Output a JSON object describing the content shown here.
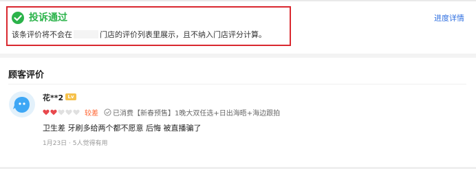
{
  "banner": {
    "title": "投诉通过",
    "desc_prefix": "该条评价将不会在",
    "desc_suffix": "门店的评价列表里展示，且不纳入门店评分计算。",
    "status_color": "#2bb34a",
    "highlight_border": "#d9272e"
  },
  "progress_link": "进度详情",
  "section_title": "顾客评价",
  "review": {
    "username": "花**2",
    "hearts_filled": 2,
    "hearts_total": 5,
    "rating_label": "较差",
    "consumed": "已消费【新春预售】1晚大双任选+日出海晤+海边跟拍",
    "text": "卫生差 牙刷多给两个都不愿意 后悔 被直播骗了",
    "date": "1月23日",
    "helpful": "5人觉得有用"
  },
  "colors": {
    "link": "#2f6fe0",
    "rating": "#ff6633",
    "heart_filled": "#e8484d",
    "heart_empty": "#e0e0e0"
  }
}
